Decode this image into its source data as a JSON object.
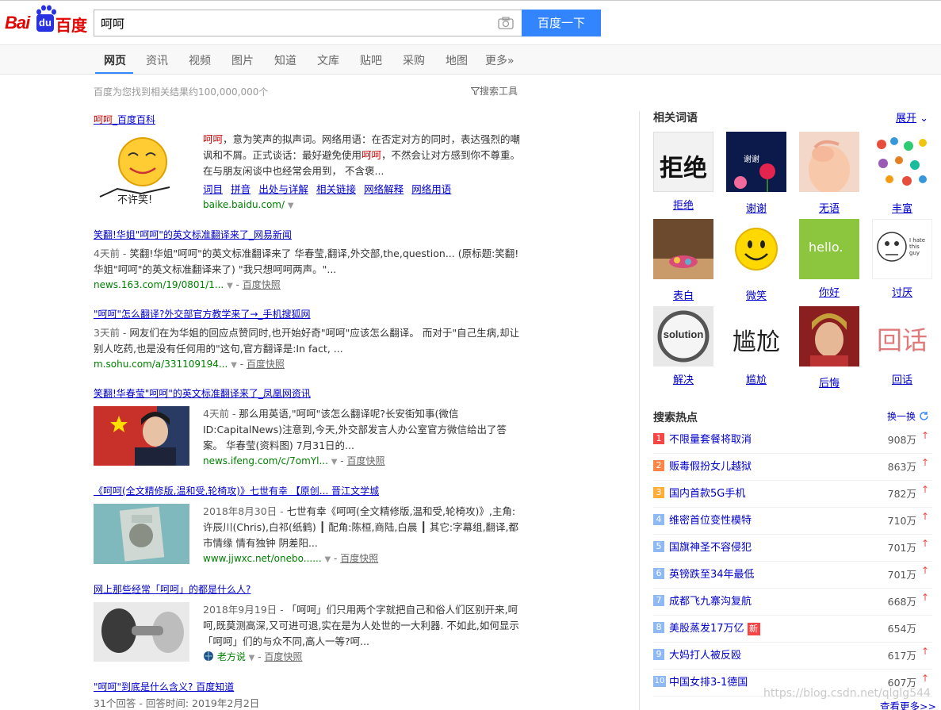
{
  "search": {
    "query": "呵呵",
    "button": "百度一下"
  },
  "logo": {
    "bai": "Bai",
    "du": "du",
    "cn": "百度"
  },
  "tabs": [
    {
      "label": "网页",
      "active": true
    },
    {
      "label": "资讯"
    },
    {
      "label": "视频"
    },
    {
      "label": "图片"
    },
    {
      "label": "知道"
    },
    {
      "label": "文库"
    },
    {
      "label": "贴吧"
    },
    {
      "label": "采购"
    },
    {
      "label": "地图"
    },
    {
      "label": "更多»"
    }
  ],
  "stats": "百度为您找到相关结果约100,000,000个",
  "tools": "搜索工具",
  "results": {
    "r0": {
      "title_em": "呵呵",
      "title_rest": "_百度百科",
      "abs1_em": "呵呵",
      "abs1": "，意为笑声的拟声词。网络用语：在否定对方的同时，表达强烈的嘲讽和不屑。正式谈话：最好避免使用",
      "abs1_em2": "呵呵",
      "abs1_tail": "，不然会让对方感到你不尊重。在与朋友闲谈中也经常会用到， 不含褒...",
      "links": [
        "词目",
        "拼音",
        "出处与详解",
        "相关链接",
        "网络解释",
        "网络用语"
      ],
      "url": "baike.baidu.com/"
    },
    "r1": {
      "title": "笑翻!华姐\"呵呵\"的英文标准翻译来了_网易新闻",
      "date": "4天前 - ",
      "abs": "笑翻!华姐\"呵呵\"的英文标准翻译来了 华春莹,翻译,外交部,the,question... (原标题:笑翻!华姐\"呵呵\"的英文标准翻译来了) \"我只想呵呵两声。\"...",
      "url": "news.163.com/19/0801/1...",
      "snap": "百度快照"
    },
    "r2": {
      "title": "\"呵呵\"怎么翻译?外交部官方教学来了→_手机搜狐网",
      "date": "3天前 - ",
      "abs": "网友们在为华姐的回应点赞同时,也开始好奇\"呵呵\"应该怎么翻译。 而对于\"自己生病,却让别人吃药,也是没有任何用的\"这句,官方翻译是:In fact, ...",
      "url": "m.sohu.com/a/331109194...",
      "snap": "百度快照"
    },
    "r3": {
      "title": "笑翻!华春莹\"呵呵\"的英文标准翻译来了_凤凰网资讯",
      "date": "4天前 - ",
      "abs": "那么用英语,\"呵呵\"该怎么翻译呢?长安街知事(微信ID:CapitalNews)注意到,今天,外交部发言人办公室官方微信给出了答案。 华春莹(资料图) 7月31日的...",
      "url": "news.ifeng.com/c/7omYl...",
      "snap": "百度快照"
    },
    "r4": {
      "title": "《呵呵(全文精修版,温和受,轮椅攻)》七世有幸 【原创... 晋江文学城",
      "date": "2018年8月30日 - ",
      "abs": "七世有幸《呵呵(全文精修版,温和受,轮椅攻)》,主角:许辰川(Chris),白祁(纸鹤) ┃ 配角:陈桓,商陆,白晨 ┃ 其它:字幕组,翻译,都市情缘 情有独钟 阴差阳...",
      "url": "www.jjwxc.net/onebo......",
      "snap": "百度快照"
    },
    "r5": {
      "title": "网上那些经常「呵呵」的都是什么人?",
      "date": "2018年9月19日 - ",
      "abs": "「呵呵」们只用两个字就把自己和俗人们区别开来,呵呵,既莫测高深,又可进可退,实在是为人处世的一大利器. 不如此,如何显示「呵呵」们的与众不同,高人一等?呵...",
      "source": "老方说",
      "snap": "百度快照"
    },
    "r6": {
      "title": "\"呵呵\"到底是什么含义? 百度知道",
      "meta": "31个回答 - 回答时间: 2019年2月2日"
    }
  },
  "related": {
    "title": "相关词语",
    "expand": "展开",
    "items": [
      {
        "label": "拒绝",
        "img_text": "拒绝"
      },
      {
        "label": "谢谢",
        "img_text": "谢谢"
      },
      {
        "label": "无语",
        "img_text": ""
      },
      {
        "label": "丰富",
        "img_text": ""
      },
      {
        "label": "表白",
        "img_text": ""
      },
      {
        "label": "微笑",
        "img_text": ""
      },
      {
        "label": "你好",
        "img_text": "hello."
      },
      {
        "label": "讨厌",
        "img_text": "I hate this guy"
      },
      {
        "label": "解决",
        "img_text": "solution"
      },
      {
        "label": "尴尬",
        "img_text": "尴尬"
      },
      {
        "label": "后悔",
        "img_text": ""
      },
      {
        "label": "回话",
        "img_text": "回话"
      }
    ]
  },
  "hot": {
    "title": "搜索热点",
    "refresh": "换一换",
    "more": "查看更多>>",
    "new_badge": "新",
    "items": [
      {
        "idx": "1",
        "title": "不限量套餐将取消",
        "count": "908万",
        "up": true,
        "color": "#f54545"
      },
      {
        "idx": "2",
        "title": "贩毒假扮女儿越狱",
        "count": "863万",
        "up": true,
        "color": "#ff8547"
      },
      {
        "idx": "3",
        "title": "国内首款5G手机",
        "count": "782万",
        "up": true,
        "color": "#ffac38"
      },
      {
        "idx": "4",
        "title": "维密首位变性模特",
        "count": "710万",
        "up": true,
        "color": "#8eb9f5"
      },
      {
        "idx": "5",
        "title": "国旗神圣不容侵犯",
        "count": "701万",
        "up": true,
        "color": "#8eb9f5"
      },
      {
        "idx": "6",
        "title": "英镑跌至34年最低",
        "count": "701万",
        "up": true,
        "color": "#8eb9f5"
      },
      {
        "idx": "7",
        "title": "成都飞九寨沟复航",
        "count": "668万",
        "up": true,
        "color": "#8eb9f5"
      },
      {
        "idx": "8",
        "title": "美股蒸发17万亿",
        "count": "654万",
        "up": false,
        "new": true,
        "color": "#8eb9f5"
      },
      {
        "idx": "9",
        "title": "大妈打人被反殴",
        "count": "617万",
        "up": true,
        "color": "#8eb9f5"
      },
      {
        "idx": "10",
        "title": "中国女排3-1德国",
        "count": "607万",
        "up": true,
        "color": "#8eb9f5"
      }
    ]
  },
  "watermark": "https://blog.csdn.net/qlglg544",
  "colors": {
    "accent": "#3385ff",
    "brand_red": "#e10602",
    "link": "#0000cc",
    "url_green": "#008000",
    "highlight": "#cc0000"
  }
}
